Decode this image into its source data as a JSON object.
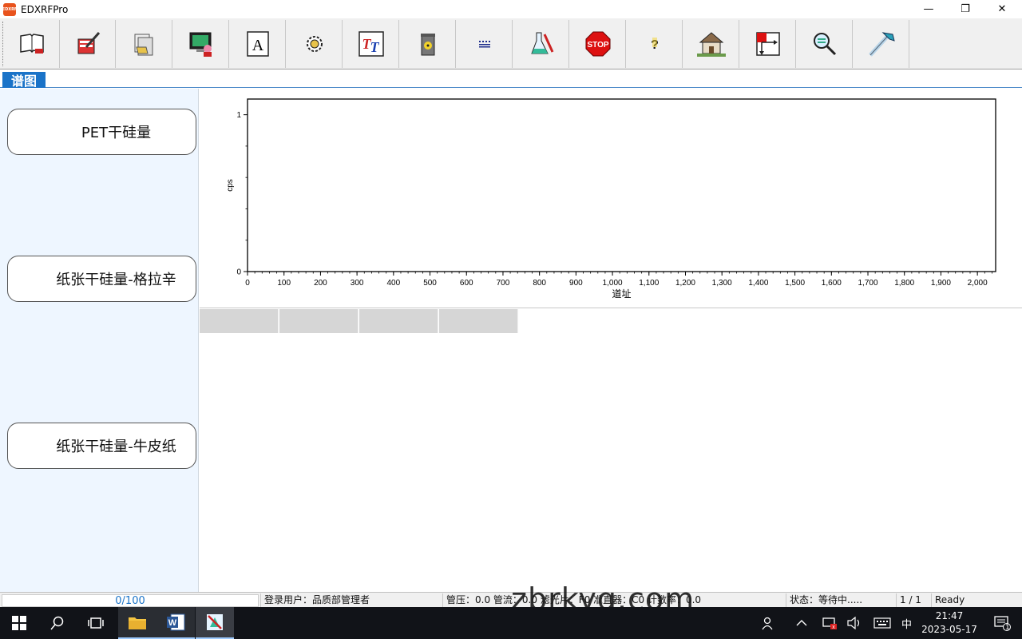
{
  "window": {
    "title": "EDXRFPro",
    "app_icon_text": "EDXRF",
    "controls": {
      "minimize": "—",
      "restore": "❐",
      "close": "✕"
    }
  },
  "toolbar": {
    "buttons": [
      {
        "name": "open-book-icon"
      },
      {
        "name": "edit-pen-icon"
      },
      {
        "name": "folder-docs-icon"
      },
      {
        "name": "monitor-user-icon"
      },
      {
        "name": "text-a-icon",
        "label": "A"
      },
      {
        "name": "gear-icon"
      },
      {
        "name": "font-tt-icon",
        "label": "TT"
      },
      {
        "name": "radiation-bin-icon"
      },
      {
        "name": "spectrum-bars-icon"
      },
      {
        "name": "lab-flask-icon"
      },
      {
        "name": "stop-sign-icon",
        "label": "STOP"
      },
      {
        "name": "help-icon",
        "label": "?"
      },
      {
        "name": "house-people-icon"
      },
      {
        "name": "chart-arrow-icon"
      },
      {
        "name": "magnifier-icon"
      },
      {
        "name": "ruler-hammer-icon"
      }
    ]
  },
  "tabs": [
    {
      "label": "谱图"
    }
  ],
  "left_panel": {
    "samples": [
      {
        "label": "PET干硅量"
      },
      {
        "label": "纸张干硅量-格拉辛"
      },
      {
        "label": "纸张干硅量-牛皮纸"
      }
    ]
  },
  "chart_data": {
    "type": "line",
    "title": "",
    "xlabel": "道址",
    "ylabel": "cps",
    "xlim": [
      0,
      2050
    ],
    "ylim": [
      0,
      1.1
    ],
    "x_ticks": [
      0,
      100,
      200,
      300,
      400,
      500,
      600,
      700,
      800,
      900,
      1000,
      1100,
      1200,
      1300,
      1400,
      1500,
      1600,
      1700,
      1800,
      1900,
      2000
    ],
    "x_tick_labels": [
      "0",
      "100",
      "200",
      "300",
      "400",
      "500",
      "600",
      "700",
      "800",
      "900",
      "1,000",
      "1,100",
      "1,200",
      "1,300",
      "1,400",
      "1,500",
      "1,600",
      "1,700",
      "1,800",
      "1,900",
      "2,000"
    ],
    "y_ticks": [
      0,
      1
    ],
    "y_tick_labels": [
      "0",
      "1"
    ],
    "series": [],
    "grid": false
  },
  "results_grid": {
    "headers": [
      "",
      "",
      "",
      ""
    ]
  },
  "status_bar": {
    "progress": "0/100",
    "user": "登录用户：品质部管理者",
    "tube": "管压：0.0  管流：0.0  滤光片：F0  准直器：C0  计数率：0.0",
    "state": "状态：等待中.....",
    "page": "1 / 1",
    "ready": "Ready"
  },
  "watermark": "zbrkyq.com",
  "taskbar": {
    "tray": {
      "ime": "中",
      "time": "21:47",
      "date": "2023-05-17",
      "notifications": "1"
    }
  }
}
